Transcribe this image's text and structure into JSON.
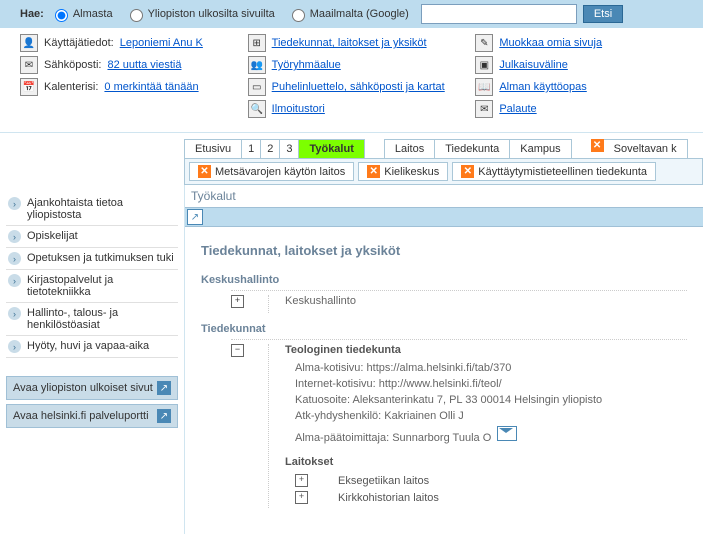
{
  "search": {
    "label": "Hae:",
    "opts": [
      "Almasta",
      "Yliopiston ulkosilta sivuilta",
      "Maailmalta (Google)"
    ],
    "btn": "Etsi",
    "placeholder": ""
  },
  "user_info": {
    "user_label": "Käyttäjätiedot:",
    "user_name": "Leponiemi Anu K",
    "mail_label": "Sähköposti:",
    "mail_link": "82 uutta viestiä",
    "cal_label": "Kalenterisi:",
    "cal_link": "0 merkintää tänään"
  },
  "center_links": {
    "l1": "Tiedekunnat, laitokset ja yksiköt",
    "l2": "Työryhmäalue",
    "l3": "Puhelinluettelo, sähköposti ja kartat",
    "l4": "Ilmoitustori"
  },
  "right_links": {
    "l1": "Muokkaa omia sivuja",
    "l2": "Julkaisuväline",
    "l3": "Alman käyttöopas",
    "l4": "Palaute"
  },
  "tabs": {
    "t1": "Etusivu",
    "tn1": "1",
    "tn2": "2",
    "tn3": "3",
    "active": "Työkalut",
    "t5": "Laitos",
    "t6": "Tiedekunta",
    "t7": "Kampus",
    "extra": "Soveltavan k"
  },
  "subtabs": {
    "s1": "Metsävarojen käytön laitos",
    "s2": "Kielikeskus",
    "s3": "Käyttäytymistieteellinen tiedekunta"
  },
  "sidebar": {
    "items": [
      "Ajankohtaista tietoa yliopistosta",
      "Opiskelijat",
      "Opetuksen ja tutkimuksen tuki",
      "Kirjastopalvelut ja tietotekniikka",
      "Hallinto-, talous- ja henkilöstöasiat",
      "Hyöty, huvi ja vapaa-aika"
    ],
    "ext": [
      "Avaa yliopiston ulkoiset sivut",
      "Avaa helsinki.fi palveluportti"
    ]
  },
  "main": {
    "panel_title": "Työkalut",
    "heading": "Tiedekunnat, laitokset ja yksiköt",
    "sec1": "Keskushallinto",
    "sec1_item": "Keskushallinto",
    "sec2": "Tiedekunnat",
    "fac": "Teologinen tiedekunta",
    "d1": "Alma-kotisivu: https://alma.helsinki.fi/tab/370",
    "d2": "Internet-kotisivu: http://www.helsinki.fi/teol/",
    "d3": "Katuosoite: Aleksanterinkatu 7, PL 33 00014 Helsingin yliopisto",
    "d4": "Atk-yhdyshenkilö: Kakriainen Olli J",
    "d5": "Alma-päätoimittaja: Sunnarborg Tuula O",
    "sub_head": "Laitokset",
    "dep1": "Eksegetiikan laitos",
    "dep2": "Kirkkohistorian laitos"
  }
}
